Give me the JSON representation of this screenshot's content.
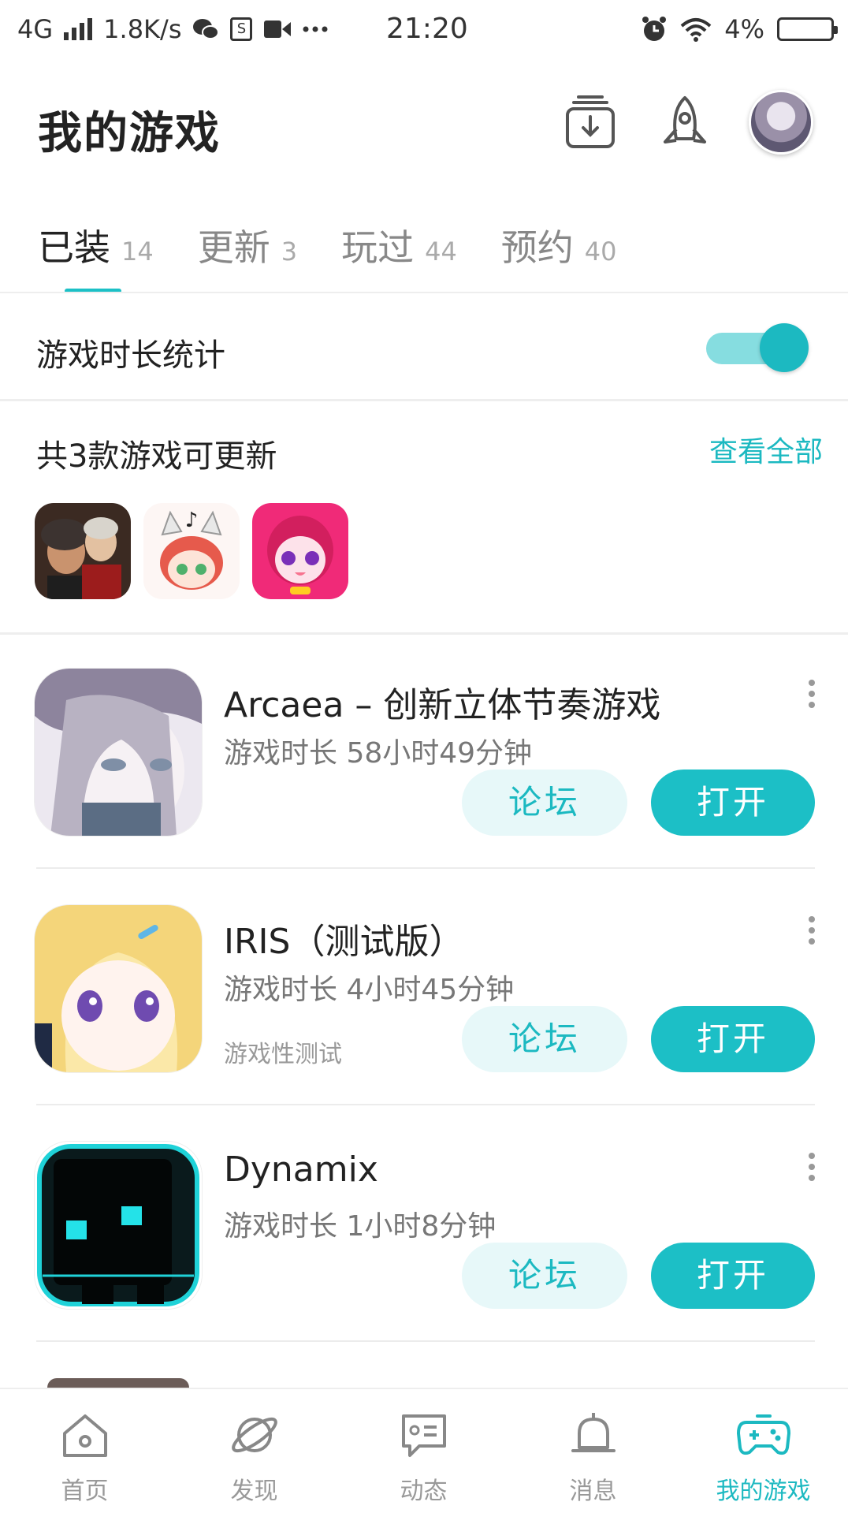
{
  "status_bar": {
    "network": "4G",
    "speed": "1.8K/s",
    "time": "21:20",
    "battery": "4%",
    "icons": [
      "signal-icon",
      "wechat-icon",
      "s-app-icon",
      "video-icon",
      "more-dots-icon",
      "alarm-icon",
      "wifi-icon",
      "battery-icon"
    ]
  },
  "header": {
    "title": "我的游戏",
    "icons": [
      "download-manager-icon",
      "rocket-icon",
      "user-avatar"
    ]
  },
  "tabs": [
    {
      "label": "已装",
      "count": "14"
    },
    {
      "label": "更新",
      "count": "3"
    },
    {
      "label": "玩过",
      "count": "44"
    },
    {
      "label": "预约",
      "count": "40"
    }
  ],
  "playtime": {
    "label": "游戏时长统计",
    "enabled": true
  },
  "updates": {
    "title": "共3款游戏可更新",
    "view_all": "查看全部",
    "icons": [
      "beethoven-game-icon",
      "cat-girl-game-icon",
      "pink-girl-game-icon"
    ]
  },
  "games": [
    {
      "name": "Arcaea – 创新立体节奏游戏",
      "time": "游戏时长 58小时49分钟",
      "note": "",
      "forum": "论坛",
      "open": "打开"
    },
    {
      "name": "IRIS（测试版）",
      "time": "游戏时长 4小时45分钟",
      "note": "游戏性测试",
      "forum": "论坛",
      "open": "打开"
    },
    {
      "name": "Dynamix",
      "time": "游戏时长 1小时8分钟",
      "note": "",
      "forum": "论坛",
      "open": "打开"
    }
  ],
  "bottom_nav": [
    {
      "label": "首页",
      "icon": "home-icon"
    },
    {
      "label": "发现",
      "icon": "planet-icon"
    },
    {
      "label": "动态",
      "icon": "chat-card-icon"
    },
    {
      "label": "消息",
      "icon": "bell-icon"
    },
    {
      "label": "我的游戏",
      "icon": "gamepad-icon",
      "active": true
    }
  ],
  "colors": {
    "accent": "#1cbfc6",
    "accent_light": "#e7f8f9",
    "toggle_track": "#86dde0"
  }
}
